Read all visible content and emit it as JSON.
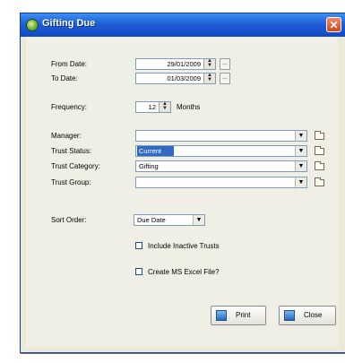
{
  "window": {
    "title": "Gifting Due",
    "close_glyph": "✕"
  },
  "form": {
    "from_date": {
      "label": "From Date:",
      "value": "29/01/2009"
    },
    "to_date": {
      "label": "To Date:",
      "value": "01/03/2009"
    },
    "date_button_label": "...",
    "frequency": {
      "label": "Frequency:",
      "value": "12",
      "unit": "Months"
    },
    "manager": {
      "label": "Manager:",
      "value": ""
    },
    "trust_status": {
      "label": "Trust Status:",
      "value": "Current"
    },
    "trust_category": {
      "label": "Trust Category:",
      "value": "Gifting"
    },
    "trust_group": {
      "label": "Trust Group:",
      "value": ""
    },
    "sort_order": {
      "label": "Sort Order:",
      "value": "Due Date"
    },
    "include_inactive": {
      "label": "Include Inactive Trusts",
      "checked": false
    },
    "create_excel": {
      "label": "Create MS Excel File?",
      "checked": false
    }
  },
  "buttons": {
    "print": "Print",
    "close": "Close"
  },
  "icons": {
    "app": "gift-app-icon",
    "close": "close-icon",
    "spin": "spin-updown-icon",
    "dropdown": "dropdown-arrow-icon",
    "folder": "folder-icon",
    "print": "printer-icon",
    "close_btn": "door-exit-icon"
  },
  "colors": {
    "titlebar": "#1f5fd6",
    "selection": "#316ac5",
    "close_button": "#d54218"
  }
}
